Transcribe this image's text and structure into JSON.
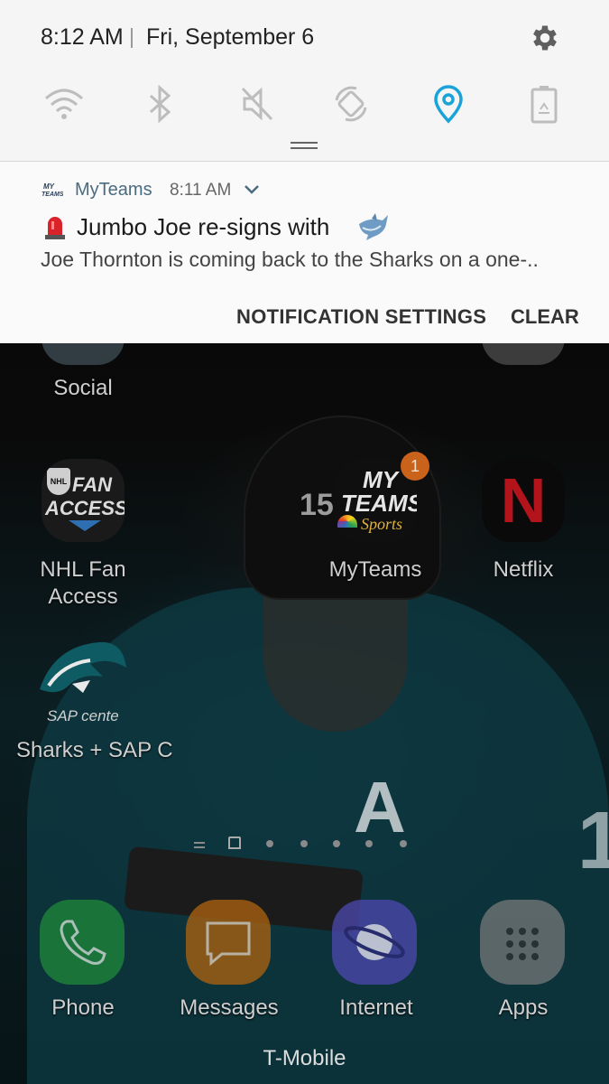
{
  "status_bar": {
    "time": "8:12 AM",
    "date": "Fri, September 6"
  },
  "quick_settings": [
    {
      "icon": "wifi-icon",
      "active": false
    },
    {
      "icon": "bluetooth-icon",
      "active": false
    },
    {
      "icon": "mute-icon",
      "active": false
    },
    {
      "icon": "auto-rotate-icon",
      "active": false
    },
    {
      "icon": "location-icon",
      "active": true
    },
    {
      "icon": "power-saving-icon",
      "active": false
    }
  ],
  "notification": {
    "app_name": "MyTeams",
    "time": "8:11 AM",
    "title": "Jumbo Joe re-signs with",
    "body": "Joe Thornton is coming back to the Sharks on a one-..",
    "actions": {
      "settings_label": "NOTIFICATION SETTINGS",
      "clear_label": "CLEAR"
    }
  },
  "home": {
    "folder_label": "Social",
    "apps": [
      {
        "label_line1": "NHL Fan",
        "label_line2": "Access"
      },
      {
        "label_line1": "MyTeams",
        "badge": "1"
      },
      {
        "label_line1": "Netflix"
      },
      {
        "label_line1": "Sharks + SAP C"
      }
    ],
    "nhl_icon_text": {
      "line1": "FAN",
      "line2": "ACCESS",
      "logo": "NHL"
    },
    "myteams_icon_text": {
      "line1": "MY",
      "line2": "TEAMS",
      "line3": "Sports"
    },
    "netflix_icon_text": "N",
    "sharks_icon_text": "SAP cente",
    "jersey": {
      "letter": "A",
      "number": "1",
      "helmet_number": "15"
    }
  },
  "dock": [
    {
      "label": "Phone",
      "color": "#1f8a3b"
    },
    {
      "label": "Messages",
      "color": "#b06410"
    },
    {
      "label": "Internet",
      "color": "#4a46a8"
    },
    {
      "label": "Apps",
      "color": "#7d7d7d"
    }
  ],
  "carrier": "T-Mobile",
  "colors": {
    "accent_location": "#1aa3d9",
    "shade_bg": "#f5f5f5"
  }
}
